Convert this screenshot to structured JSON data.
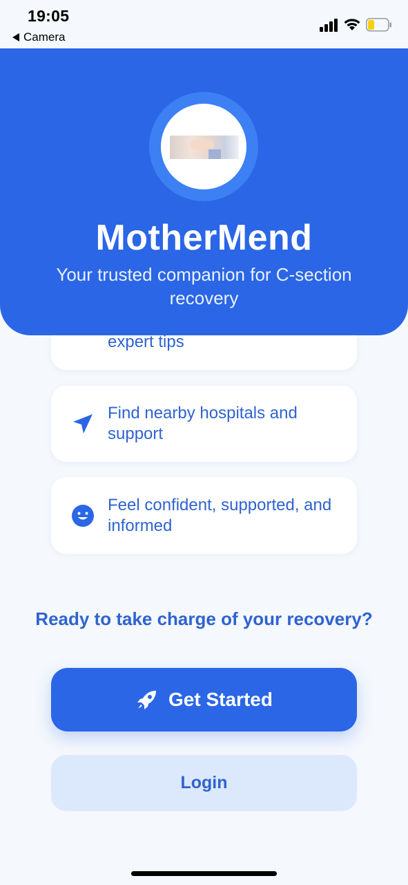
{
  "status_bar": {
    "time": "19:05",
    "back_label": "Camera",
    "icons": [
      "signal-icon",
      "wifi-icon",
      "battery-icon"
    ]
  },
  "header": {
    "app_name": "MotherMend",
    "tagline": "Your trusted companion for C-section recovery",
    "logo_icon": "mother-baby-photo"
  },
  "features": [
    {
      "icon": "bulb-icon",
      "text": "expert tips"
    },
    {
      "icon": "navigation-arrow-icon",
      "text": "Find nearby hospitals and support"
    },
    {
      "icon": "smile-icon",
      "text": "Feel confident, supported, and informed"
    }
  ],
  "prompt": "Ready to take charge of your recovery?",
  "buttons": {
    "get_started": "Get Started",
    "get_started_icon": "rocket-icon",
    "login": "Login"
  },
  "colors": {
    "primary": "#2a66e6",
    "primary_text": "#2f63d0",
    "secondary_bg": "#dce8fb",
    "background": "#f5f8fc"
  }
}
